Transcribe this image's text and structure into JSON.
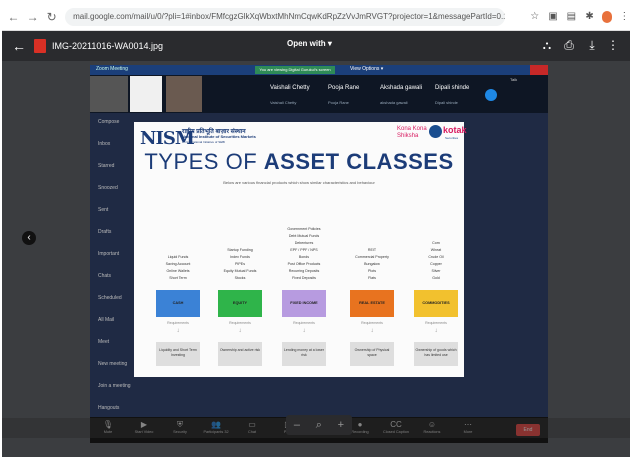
{
  "browser": {
    "url": "mail.google.com/mail/u/0/?pli=1#inbox/FMfcgzGlkXqWbxtMhNmCqwKdRpZzVvJmRVGT?projector=1&messagePartId=0.1"
  },
  "viewer": {
    "file_name": "IMG-20211016-WA0014.jpg",
    "open_with_label": "Open with ▾",
    "icons": [
      "add-to-drive-icon",
      "print-icon",
      "download-icon",
      "more-vert-icon"
    ]
  },
  "meeting": {
    "window_title": "Zoom Meeting",
    "share_bar": "You are viewing Digital Gurukul's screen",
    "view_options": "View Options ▾",
    "participants": [
      {
        "name": "Vaishali Chetty",
        "sub": "Vaishali Chetty"
      },
      {
        "name": "Pooja Rane",
        "sub": "Pooja Rane"
      },
      {
        "name": "Akshada gawali",
        "sub": "akshada gawali"
      },
      {
        "name": "Dipali shinde",
        "sub": "Dipali shinde"
      }
    ],
    "side_label": "Talk",
    "controls": [
      {
        "icon": "mic-icon",
        "label": "Mute"
      },
      {
        "icon": "video-icon",
        "label": "Start Video"
      },
      {
        "icon": "shield-icon",
        "label": "Security"
      },
      {
        "icon": "participants-icon",
        "label": "Participants",
        "badge": "32"
      },
      {
        "icon": "chat-icon",
        "label": "Chat"
      },
      {
        "icon": "poll-icon",
        "label": "Polls"
      },
      {
        "icon": "share-icon",
        "label": "Share Screen"
      },
      {
        "icon": "record-icon",
        "label": "Recording"
      },
      {
        "icon": "captions-icon",
        "label": "Closed Caption"
      },
      {
        "icon": "reactions-icon",
        "label": "Reactions"
      },
      {
        "icon": "more-icon",
        "label": "More"
      }
    ],
    "end_label": "End"
  },
  "gmail_left": {
    "items": [
      "Compose",
      "Inbox",
      "Starred",
      "Snoozed",
      "Sent",
      "Drafts",
      "Important",
      "Chats",
      "Scheduled",
      "All Mail",
      "Meet",
      "New meeting",
      "Join a meeting",
      "Hangouts"
    ]
  },
  "slide": {
    "nism_logo": "NISM",
    "nism_hindi": "राष्ट्रीय प्रतिभूति बाज़ार संस्थान",
    "nism_english": "National Institute of Securities Markets",
    "nism_sub": "An Educational Initiative of SEBI",
    "kona_kona": "Kona Kona Shiksha",
    "kotak_brand": "kotak",
    "kotak_sub": "Securities",
    "title_part1": "TYPES OF",
    "title_part2": "ASSET CLASSES",
    "subtitle": "Below are various financial products which show similar characteristics and behaviour",
    "classes": [
      {
        "name": "CASH",
        "color": "#3b82d6",
        "examples": [
          "Liquid Funds",
          "Saving Account",
          "Online Wallets",
          "Short Term"
        ],
        "requirements": "Requirements",
        "risk": "Liquidity and Short Term Investing"
      },
      {
        "name": "EQUITY",
        "color": "#2fb44a",
        "examples": [
          "Startup Funding",
          "Index Funds",
          "PIPEs",
          "Equity Mutual Funds",
          "Stocks"
        ],
        "requirements": "Requirements",
        "risk": "Ownership and active risk"
      },
      {
        "name": "FIXED INCOME",
        "color": "#b79be0",
        "examples": [
          "Government Policies",
          "Debt Mutual Funds",
          "Debentures",
          "EPF / PPF / NPS",
          "Bonds",
          "Post Office Products",
          "Recurring Deposits",
          "Fixed Deposits"
        ],
        "requirements": "Requirements",
        "risk": "Lending money at a lower risk"
      },
      {
        "name": "REAL ESTATE",
        "color": "#e8731f",
        "examples": [
          "REIT",
          "Commercial Property",
          "Bungalow",
          "Plots",
          "Flats"
        ],
        "requirements": "Requirements",
        "risk": "Ownership of Physical space"
      },
      {
        "name": "COMMODITIES",
        "color": "#f2c12e",
        "examples": [
          "Corn",
          "Wheat",
          "Crude Oil",
          "Copper",
          "Silver",
          "Gold"
        ],
        "requirements": "Requirements",
        "risk": "Ownership of goods which has limited use"
      }
    ]
  },
  "zoom_controls": {
    "minus": "–",
    "zoom": "⌕",
    "plus": "+"
  }
}
